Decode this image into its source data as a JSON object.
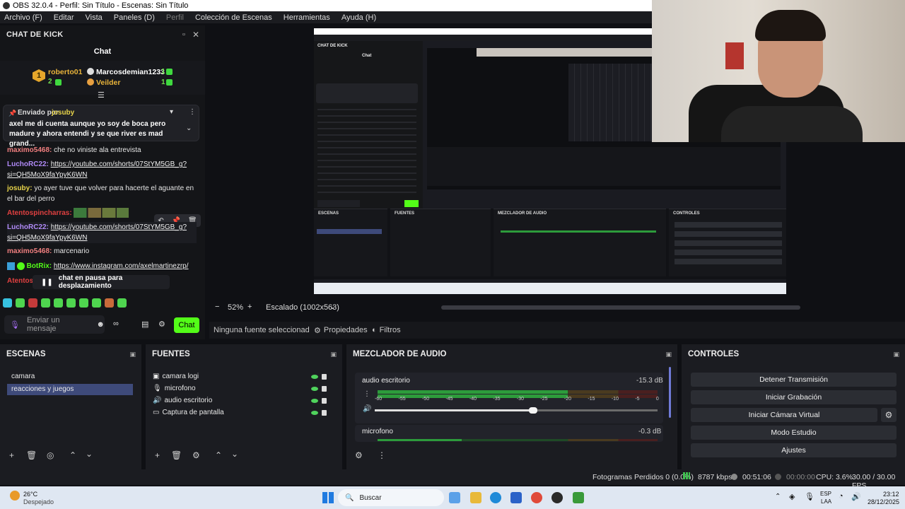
{
  "window": {
    "title": "OBS 32.0.4 - Perfil: Sin Título - Escenas: Sin Título"
  },
  "menu": [
    "Archivo (F)",
    "Editar",
    "Vista",
    "Paneles (D)",
    "Perfil",
    "Colección de Escenas",
    "Herramientas",
    "Ayuda (H)"
  ],
  "chat": {
    "dock_title": "CHAT DE KICK",
    "header": "Chat",
    "leaderboard": [
      {
        "name": "roberto01",
        "count": "2",
        "color": "#e8b33a"
      },
      {
        "name": "Marcosdemian1233",
        "count": "1",
        "color": "#ffffff"
      },
      {
        "name": "Veilder",
        "count": "1",
        "color": "#e8b33a"
      }
    ],
    "rank_badge": "1",
    "pinned": {
      "label": "Enviado por",
      "user": "josuby",
      "text": "axel me di cuenta aunque yo soy de boca pero madure y ahora entendi y se que river es mad grand..."
    },
    "messages": [
      {
        "user": "maximo5468:",
        "text": "che no viniste ala entrevista",
        "color": "#f07f7f"
      },
      {
        "user": "LuchoRC22:",
        "text": "https://youtube.com/shorts/07StYM5GB_g?si=QH5MoX9faYpyK6WN",
        "color": "#b08af7",
        "link": true
      },
      {
        "user": "josuby:",
        "text": "yo ayer tuve que volver para hacerte el aguante en el bar del perro",
        "color": "#e8d44a"
      },
      {
        "user": "Atentospincharras:",
        "text": "",
        "color": "#e04040"
      },
      {
        "user": "LuchoRC22:",
        "text": "https://youtube.com/shorts/07StYM5GB_g?si=QH5MoX9faYpyK6WN",
        "color": "#b08af7",
        "link": true
      },
      {
        "user": "maximo5468:",
        "text": "marcenario",
        "color": "#f07f7f"
      },
      {
        "user": "BotRix:",
        "text": "https://www.instagram.com/axelmartinezrp/",
        "color": "#53fc18",
        "link": true
      },
      {
        "user": "Atentosp",
        "text": "",
        "color": "#e04040"
      }
    ],
    "pause_banner": "chat en pausa para desplazamiento",
    "input_placeholder": "Enviar un mensaje",
    "send_label": "Chat"
  },
  "preview": {
    "zoom": "52%",
    "zoom_minus": "−",
    "zoom_plus": "+",
    "scale": "Escalado (1002x563)",
    "mini_title": "CHAT DE KICK",
    "mini_chat": "Chat",
    "mini_docks": [
      "ESCENAS",
      "FUENTES",
      "MEZCLADOR DE AUDIO",
      "CONTROLES"
    ]
  },
  "source_bar": {
    "no_source": "Ninguna fuente seleccionad",
    "properties": "Propiedades",
    "filters": "Filtros"
  },
  "scenes": {
    "title": "ESCENAS",
    "items": [
      "camara",
      "reacciones y juegos"
    ],
    "selected": 1
  },
  "sources": {
    "title": "FUENTES",
    "items": [
      "camara logi",
      "microfono",
      "audio escritorio",
      "Captura de pantalla"
    ]
  },
  "mixer": {
    "title": "MEZCLADOR DE AUDIO",
    "ticks": [
      "-60",
      "-55",
      "-50",
      "-45",
      "-40",
      "-35",
      "-30",
      "-25",
      "-20",
      "-15",
      "-10",
      "-5",
      "0"
    ],
    "channels": [
      {
        "name": "audio escritorio",
        "db": "-15.3 dB",
        "level": 0.68
      },
      {
        "name": "microfono",
        "db": "-0.3 dB",
        "level": 0.3
      }
    ],
    "volume": 0.56
  },
  "controls": {
    "title": "CONTROLES",
    "buttons": [
      "Detener Transmisión",
      "Iniciar Grabación",
      "Iniciar Cámara Virtual",
      "Modo Estudio",
      "Ajustes"
    ]
  },
  "status": {
    "dropped": "Fotogramas Perdidos 0 (0.0%)",
    "kbps": "8787 kbps",
    "stream_time": "00:51:06",
    "rec_time": "00:00:00",
    "cpu": "CPU: 3.6%",
    "fps": "30.00 / 30.00 FPS"
  },
  "taskbar": {
    "weather_temp": "26°C",
    "weather_desc": "Despejado",
    "search": "Buscar",
    "lang1": "ESP",
    "lang2": "LAA",
    "time": "23:12",
    "date": "28/12/2025"
  },
  "colors": {
    "kick_green": "#53fc18",
    "selected_scene": "#3e4a7a",
    "meter_green": "#2d9b3b"
  }
}
